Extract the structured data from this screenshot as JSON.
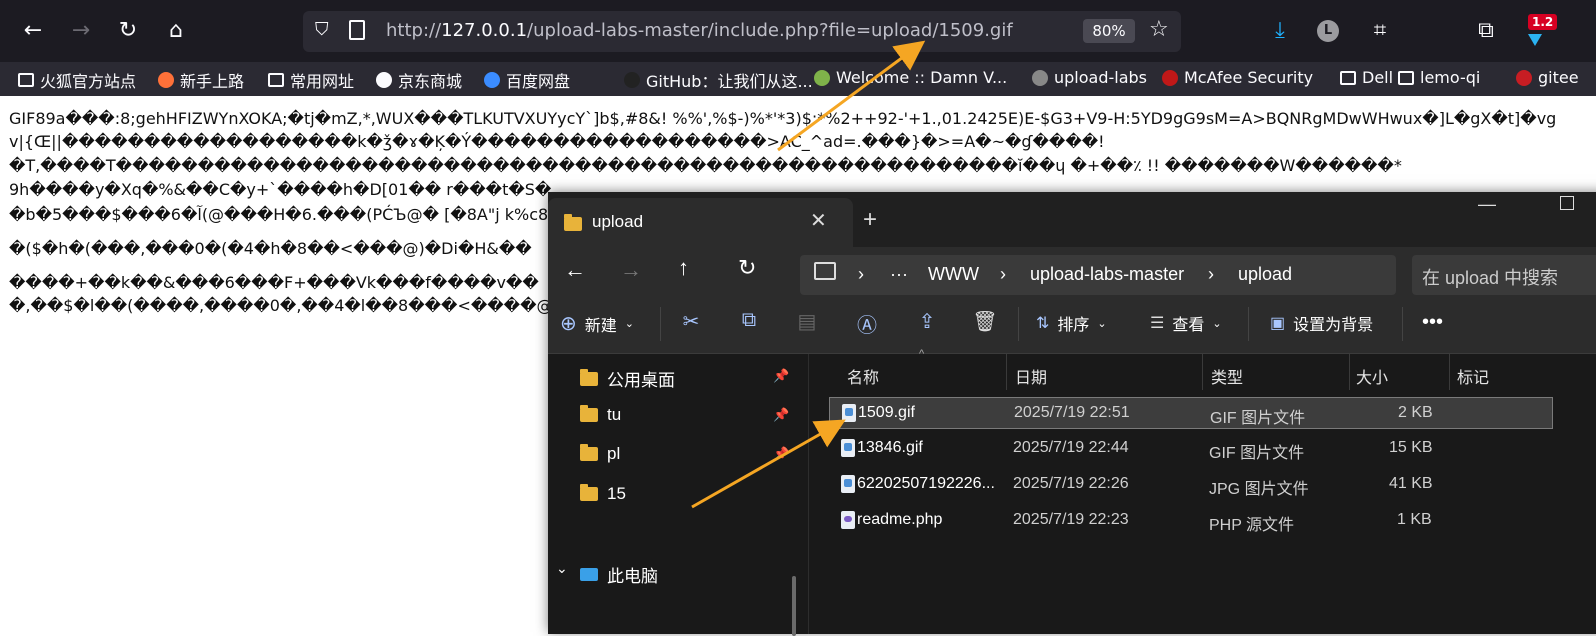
{
  "browser": {
    "url_prefix": "http://",
    "url_host": "127.0.0.1",
    "url_path": "/upload-labs-master/include.php?file=upload/1509.gif",
    "zoom": "80%",
    "badge": "1.2",
    "profile_letter": "L"
  },
  "bookmarks": [
    {
      "label": "火狐官方站点",
      "icon": "folder-icon"
    },
    {
      "label": "新手上路",
      "icon": "firefox-icon"
    },
    {
      "label": "常用网址",
      "icon": "folder-icon"
    },
    {
      "label": "京东商城",
      "icon": "globe-icon"
    },
    {
      "label": "百度网盘",
      "icon": "baidu-pan-icon"
    },
    {
      "label": "GitHub：让我们从这...",
      "icon": "github-icon"
    },
    {
      "label": "Welcome :: Damn V...",
      "icon": "dvwa-icon"
    },
    {
      "label": "upload-labs",
      "icon": "upload-labs-icon"
    },
    {
      "label": "McAfee Security",
      "icon": "mcafee-icon"
    },
    {
      "label": "Dell",
      "icon": "folder-icon"
    },
    {
      "label": "lemo-qi",
      "icon": "folder-icon"
    },
    {
      "label": "gitee",
      "icon": "gitee-icon"
    }
  ],
  "page_text": [
    "GIF89a���:8;gehHFIZWYnXOKA;�tj�mZ,*,WUX���TLKUTVXUYycY`]b$,#8&! %%',%$-)%*'*3)$:*%2++92-'+1.,01.2425E)E-$G3+V9-H:5YD9gG9sM=A>BQNRgMDwWHwux�]L�gX�t]�vg",
    "v|{Œ||������������������k�ǯ�ɤ�Ķ�Ý������������������>AC_^ad=.���}�>=A�~�ɠ����!",
    "�T,����T�������������������������������������������������������ĭ��ɥ �+��٪ !! �������W������*",
    "9h����y�Xq�%&��C�y+`����h�D[01�� r���t�S�",
    "�b�5���$���6�آ(@���H�6.���(PĆЪ@� [�8A\"j k%c8",
    "�($�h�(���,���0�(�4�h�8��<���@)�Di�H&��",
    "����+��k��&���6���F+���Vk���f����v��",
    "�,��$�l��(����,����0�,��4�l��8���<����@"
  ],
  "explorer": {
    "tab_title": "upload",
    "breadcrumb": [
      "WWW",
      "upload-labs-master",
      "upload"
    ],
    "search_placeholder": "在 upload 中搜索",
    "commands": {
      "new": "新建",
      "sort": "排序",
      "view": "查看",
      "set_background": "设置为背景"
    },
    "sidebar": [
      {
        "label": "公用桌面",
        "pinned": true
      },
      {
        "label": "tu",
        "pinned": true
      },
      {
        "label": "pl",
        "pinned": true
      },
      {
        "label": "15",
        "pinned": false
      },
      {
        "label": "此电脑",
        "pinned": false
      }
    ],
    "columns": [
      "名称",
      "日期",
      "类型",
      "大小",
      "标记"
    ],
    "files": [
      {
        "name": "1509.gif",
        "date": "2025/7/19 22:51",
        "type": "GIF 图片文件",
        "size": "2 KB",
        "icon": "gif-file-icon",
        "selected": true
      },
      {
        "name": "13846.gif",
        "date": "2025/7/19 22:44",
        "type": "GIF 图片文件",
        "size": "15 KB",
        "icon": "gif-file-icon",
        "selected": false
      },
      {
        "name": "62202507192226...",
        "date": "2025/7/19 22:26",
        "type": "JPG 图片文件",
        "size": "41 KB",
        "icon": "jpg-file-icon",
        "selected": false
      },
      {
        "name": "readme.php",
        "date": "2025/7/19 22:23",
        "type": "PHP 源文件",
        "size": "1 KB",
        "icon": "php-file-icon",
        "selected": false
      }
    ]
  },
  "colors": {
    "arrow": "#f5a623",
    "browser_bg": "#1c1b22",
    "explorer_bg": "#202020"
  }
}
